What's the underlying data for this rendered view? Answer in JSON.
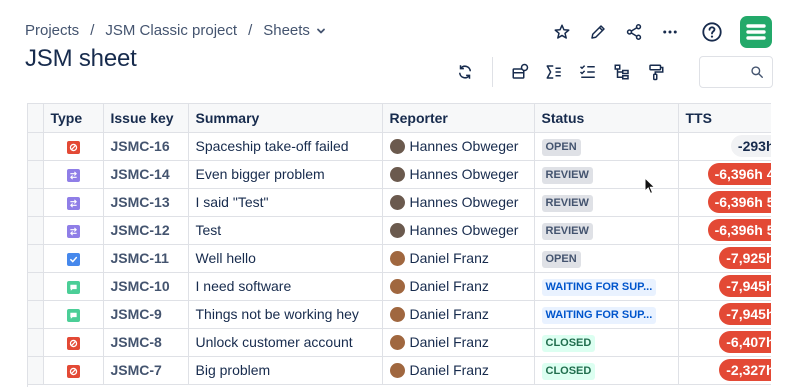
{
  "breadcrumb": {
    "projects": "Projects",
    "project": "JSM Classic project",
    "sheets": "Sheets"
  },
  "page_title": "JSM sheet",
  "top_actions": [
    "star-icon",
    "edit-icon",
    "share-icon",
    "more-icon",
    "help-icon",
    "app-logo"
  ],
  "toolbar": [
    "refresh-icon",
    "views-icon",
    "sum-icon",
    "checklist-icon",
    "hierarchy-icon",
    "paint-format-icon"
  ],
  "search": {
    "placeholder": ""
  },
  "columns": {
    "type": "Type",
    "key": "Issue key",
    "summary": "Summary",
    "reporter": "Reporter",
    "status": "Status",
    "tts": "TTS"
  },
  "colors": {
    "open_bg": "#dfe1e6",
    "review_bg": "#dfe1e6",
    "waiting_bg": "#e9f2ff",
    "closed_bg": "#dcfff1",
    "tts_red": "#e34935",
    "accent": "#23a96a"
  },
  "rows": [
    {
      "type": "incident",
      "key": "JSMC-16",
      "summary": "Spaceship take-off failed",
      "reporter": "Hannes Obweger",
      "status": "OPEN",
      "status_kind": "open",
      "tts": "-293h",
      "tts_kind": "neutral"
    },
    {
      "type": "change",
      "key": "JSMC-14",
      "summary": "Even bigger problem",
      "reporter": "Hannes Obweger",
      "status": "REVIEW",
      "status_kind": "review",
      "tts": "-6,396h 4",
      "tts_kind": "red"
    },
    {
      "type": "change",
      "key": "JSMC-13",
      "summary": "I said \"Test\"",
      "reporter": "Hannes Obweger",
      "status": "REVIEW",
      "status_kind": "review",
      "tts": "-6,396h 5",
      "tts_kind": "red"
    },
    {
      "type": "change",
      "key": "JSMC-12",
      "summary": "Test",
      "reporter": "Hannes Obweger",
      "status": "REVIEW",
      "status_kind": "review",
      "tts": "-6,396h 5",
      "tts_kind": "red"
    },
    {
      "type": "task",
      "key": "JSMC-11",
      "summary": "Well hello",
      "reporter": "Daniel Franz",
      "status": "OPEN",
      "status_kind": "open",
      "tts": "-7,925h",
      "tts_kind": "red"
    },
    {
      "type": "service",
      "key": "JSMC-10",
      "summary": "I need software",
      "reporter": "Daniel Franz",
      "status": "WAITING FOR SUP...",
      "status_kind": "waiting",
      "tts": "-7,945h",
      "tts_kind": "red"
    },
    {
      "type": "service",
      "key": "JSMC-9",
      "summary": "Things not be working hey",
      "reporter": "Daniel Franz",
      "status": "WAITING FOR SUP...",
      "status_kind": "waiting",
      "tts": "-7,945h",
      "tts_kind": "red"
    },
    {
      "type": "incident",
      "key": "JSMC-8",
      "summary": "Unlock customer account",
      "reporter": "Daniel Franz",
      "status": "CLOSED",
      "status_kind": "closed",
      "tts": "-6,407h",
      "tts_kind": "red"
    },
    {
      "type": "incident",
      "key": "JSMC-7",
      "summary": "Big problem",
      "reporter": "Daniel Franz",
      "status": "CLOSED",
      "status_kind": "closed",
      "tts": "-2,327h",
      "tts_kind": "red"
    }
  ]
}
